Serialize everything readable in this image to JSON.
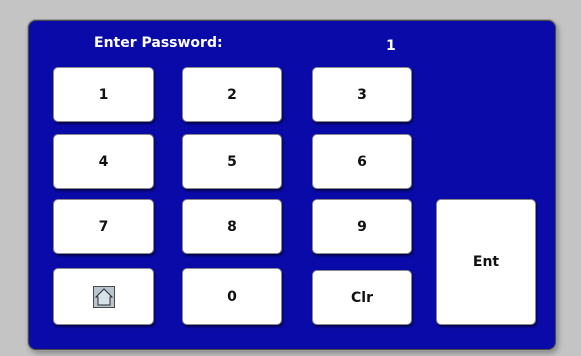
{
  "keypad": {
    "title": "Enter Password:",
    "entry": "1",
    "keys": {
      "k1": "1",
      "k2": "2",
      "k3": "3",
      "k4": "4",
      "k5": "5",
      "k6": "6",
      "k7": "7",
      "k8": "8",
      "k9": "9",
      "k0": "0",
      "clear": "Clr",
      "enter": "Ent",
      "home_icon": "home-icon"
    }
  },
  "colors": {
    "panel": "#0a0aa8",
    "background": "#c4c4c4",
    "key": "#ffffff",
    "label": "#ffffff"
  }
}
